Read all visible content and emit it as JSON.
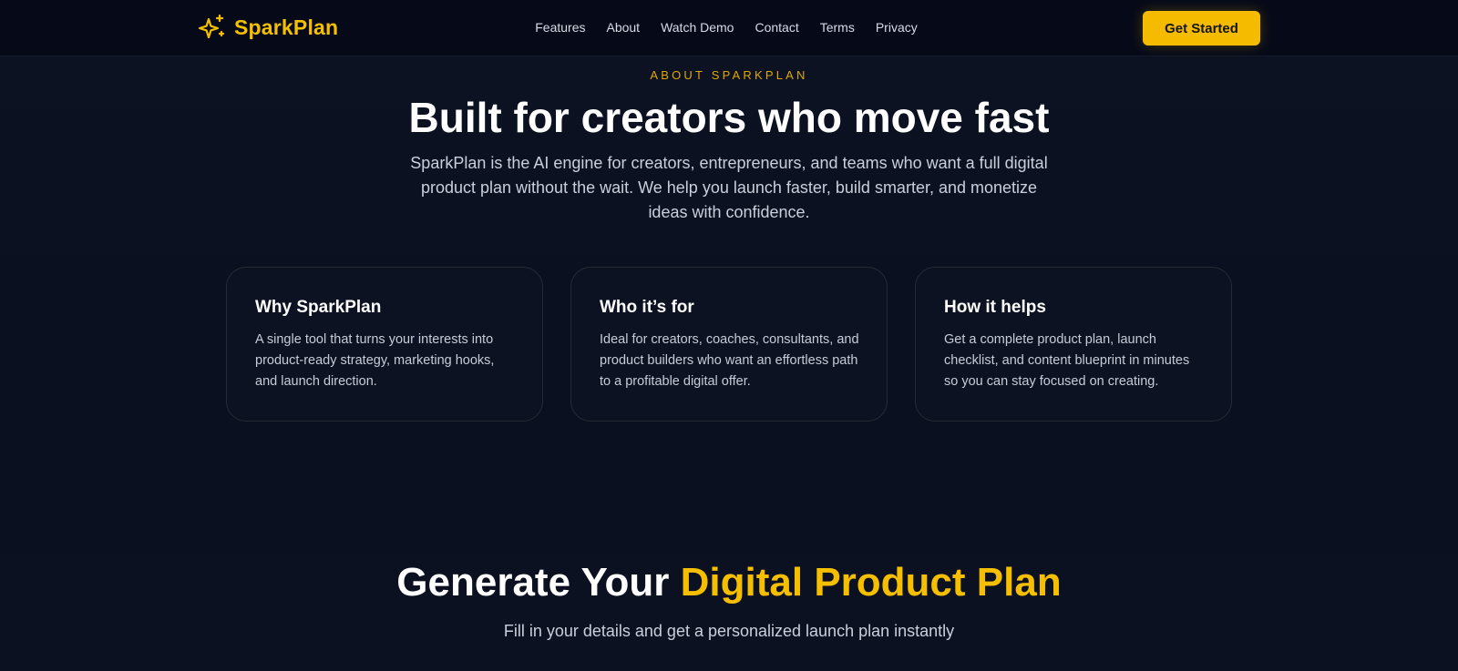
{
  "nav": {
    "brand_name": "SparkPlan",
    "links": [
      "Features",
      "About",
      "Watch Demo",
      "Contact",
      "Terms",
      "Privacy"
    ],
    "cta_label": "Get Started"
  },
  "about": {
    "eyebrow": "ABOUT SPARKPLAN",
    "title": "Built for creators who move fast",
    "description": "SparkPlan is the AI engine for creators, entrepreneurs, and teams who want a full digital product plan without the wait. We help you launch faster, build smarter, and monetize ideas with confidence.",
    "cards": [
      {
        "title": "Why SparkPlan",
        "text": "A single tool that turns your interests into product-ready strategy, marketing hooks, and launch direction."
      },
      {
        "title": "Who it’s for",
        "text": "Ideal for creators, coaches, consultants, and product builders who want an effortless path to a profitable digital offer."
      },
      {
        "title": "How it helps",
        "text": "Get a complete product plan, launch checklist, and content blueprint in minutes so you can stay focused on creating."
      }
    ]
  },
  "generate": {
    "title_prefix": "Generate Your ",
    "title_highlight": "Digital Product Plan",
    "subtitle": "Fill in your details and get a personalized launch plan instantly"
  },
  "colors": {
    "accent": "#f5bb00",
    "background": "#0b1020",
    "nav_background": "#060a18"
  },
  "icons": {
    "brand": "sparkles-icon"
  }
}
